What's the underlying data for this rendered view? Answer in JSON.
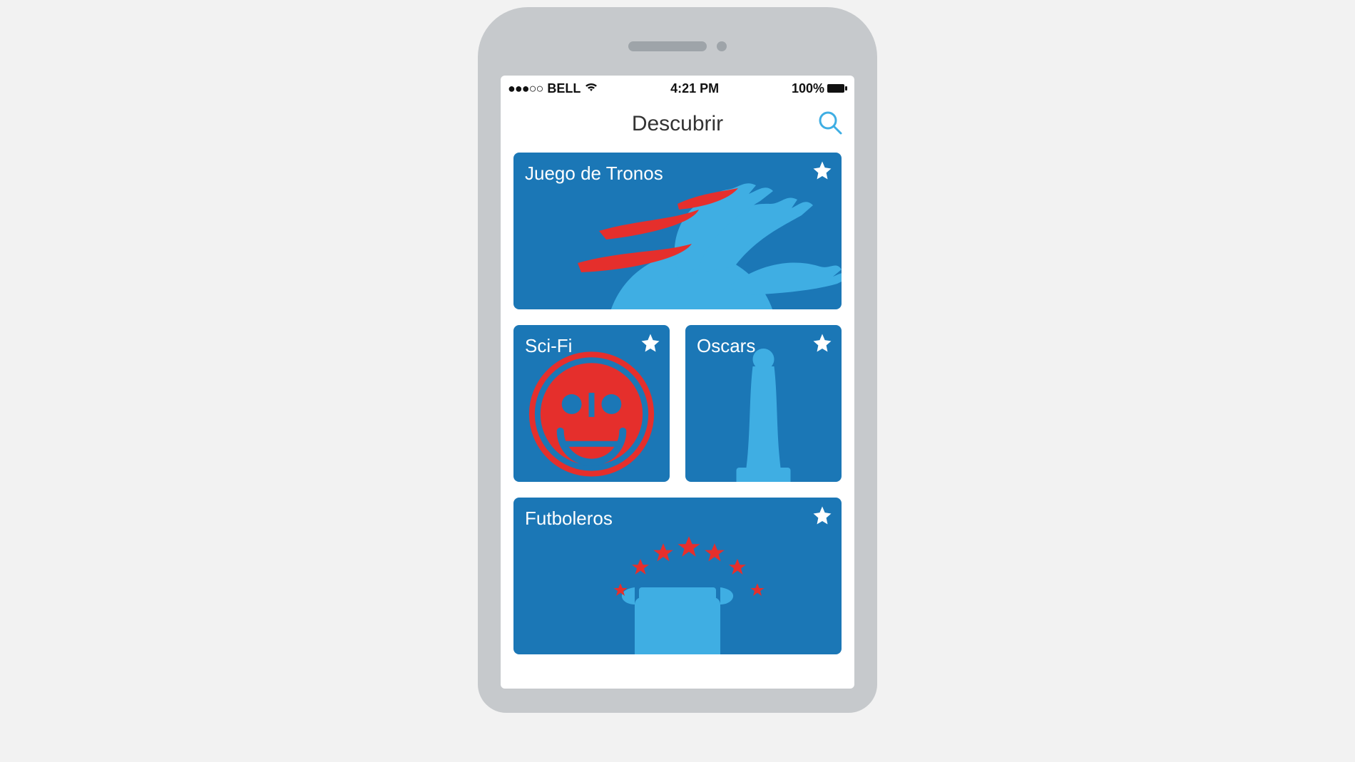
{
  "status": {
    "carrier": "BELL",
    "time": "4:21 PM",
    "battery": "100%"
  },
  "header": {
    "title": "Descubrir"
  },
  "cards": {
    "hydra": {
      "label": "Juego de Tronos"
    },
    "scifi": {
      "label": "Sci-Fi"
    },
    "oscars": {
      "label": "Oscars"
    },
    "futbol": {
      "label": "Futboleros"
    }
  },
  "colors": {
    "card_bg": "#1B77B6",
    "accent_light": "#3FAEE3",
    "accent_red": "#E52F2C"
  }
}
